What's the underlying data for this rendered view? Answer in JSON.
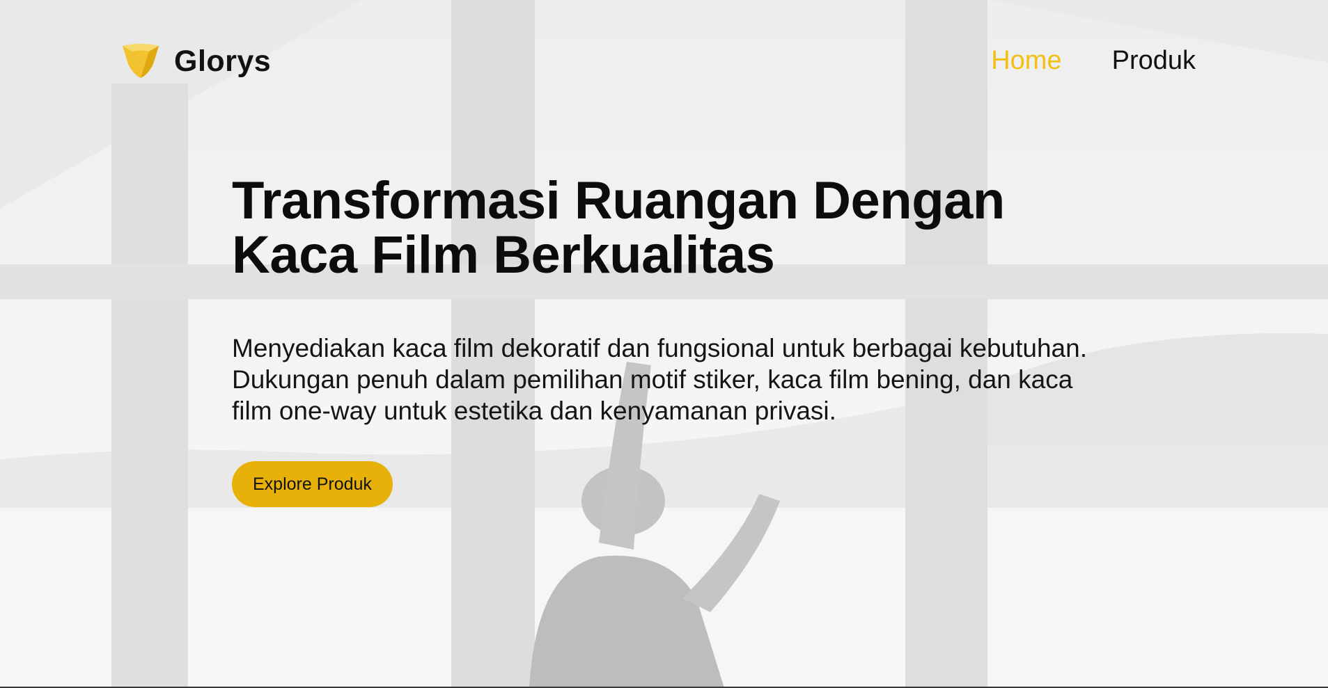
{
  "brand": {
    "name": "Glorys",
    "logo_icon": "shield-icon",
    "logo_color": "#f2c230"
  },
  "nav": {
    "items": [
      {
        "label": "Home",
        "active": true
      },
      {
        "label": "Produk",
        "active": false
      }
    ],
    "active_color": "#f2bf14"
  },
  "hero": {
    "title": "Transformasi Ruangan Dengan Kaca Film Berkualitas",
    "description": "Menyediakan kaca film dekoratif dan fungsional untuk berbagai kebutuhan. Dukungan penuh dalam pemilihan motif stiker, kaca film bening, dan kaca film one-way untuk estetika dan kenyamanan privasi.",
    "cta_label": "Explore Produk",
    "cta_color": "#e7b10a"
  }
}
